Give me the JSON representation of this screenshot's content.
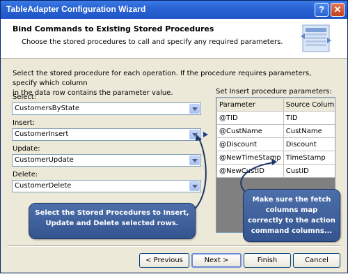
{
  "window": {
    "title": "TableAdapter Configuration Wizard",
    "help_glyph": "?",
    "close_glyph": "✕"
  },
  "header": {
    "title": "Bind Commands to Existing Stored Procedures",
    "subtitle": "Choose the stored procedures to call and specify any required parameters.",
    "icon": "database-table-icon"
  },
  "intro_line1": "Select the stored procedure for each operation. If the procedure requires parameters, specify which column",
  "intro_line2": "in the data row contains the parameter value.",
  "select": {
    "label": "Select:",
    "value": "CustomersByState"
  },
  "insert": {
    "label": "Insert:",
    "value": "CustomerInsert"
  },
  "update": {
    "label": "Update:",
    "value": "CustomerUpdate"
  },
  "delete": {
    "label": "Delete:",
    "value": "CustomerDelete"
  },
  "params": {
    "label": "Set Insert procedure parameters:",
    "columns": [
      "Parameter",
      "Source Column"
    ],
    "rows": [
      [
        "@TID",
        "TID"
      ],
      [
        "@CustName",
        "CustName"
      ],
      [
        "@Discount",
        "Discount"
      ],
      [
        "@NewTimeStamp",
        "TimeStamp"
      ],
      [
        "@NewCustID",
        "CustID"
      ]
    ]
  },
  "callout_left": {
    "line1": "Select the Stored Procedures to Insert,",
    "line2": "Update and Delete selected rows."
  },
  "callout_right": {
    "line1": "Make sure the fetch",
    "line2": "columns map",
    "line3": "correctly to the action",
    "line4": "command columns..."
  },
  "buttons": {
    "previous": "< Previous",
    "next": "Next >",
    "finish": "Finish",
    "cancel": "Cancel"
  },
  "colors": {
    "titlebar": "#2a63d4",
    "callout": "#3d5f9c",
    "grid_empty": "#808080"
  }
}
